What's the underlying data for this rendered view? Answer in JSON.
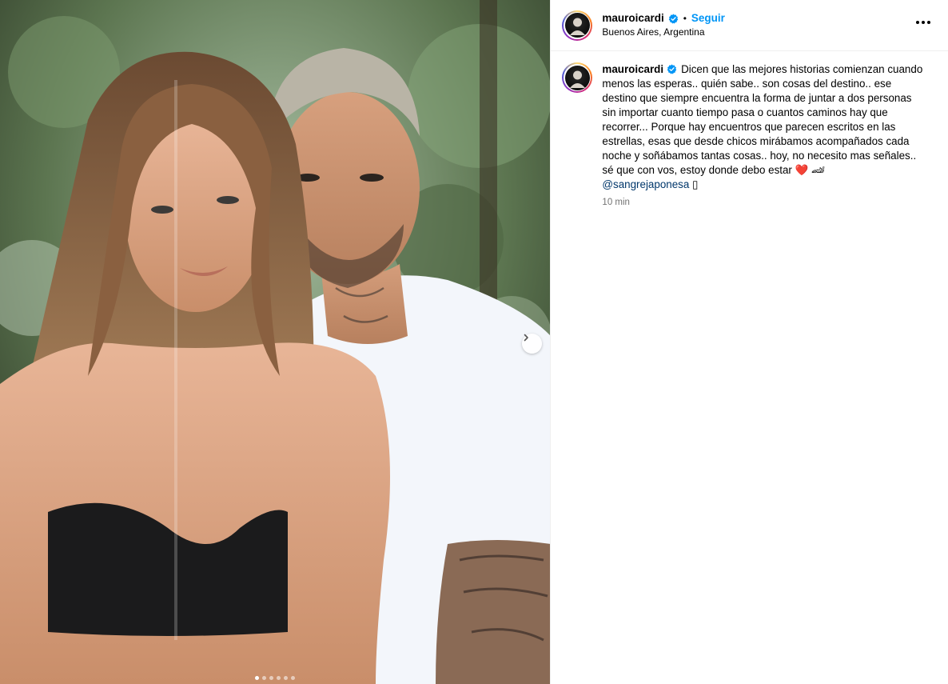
{
  "post": {
    "username": "mauroicardi",
    "follow_label": "Seguir",
    "bullet": "•",
    "location": "Buenos Aires, Argentina",
    "caption": "Dicen que las mejores historias comienzan cuando menos las esperas.. quién sabe.. son cosas del destino.. ese destino que siempre encuentra la forma de juntar a dos personas sin importar cuanto tiempo pasa o cuantos caminos hay que recorrer... Porque hay encuentros que parecen escritos en las estrellas, esas que desde chicos mirábamos acompañados cada noche y soñábamos tantas cosas.. hoy, no necesito mas señales.. sé que con vos, estoy donde debo estar",
    "emoji_heart": "❤️",
    "emoji_car": "🏎",
    "mention": "@sangrejaponesa",
    "trailing_glyph": "▯",
    "time": "10 min"
  },
  "carousel": {
    "total": 6,
    "active_index": 0
  },
  "colors": {
    "follow": "#0095f6",
    "mention": "#00376b",
    "verified": "#0095f6",
    "muted_text": "#737373"
  },
  "icons": {
    "verified": "verified-badge-icon",
    "more": "more-options-icon",
    "next": "chevron-right-icon"
  }
}
